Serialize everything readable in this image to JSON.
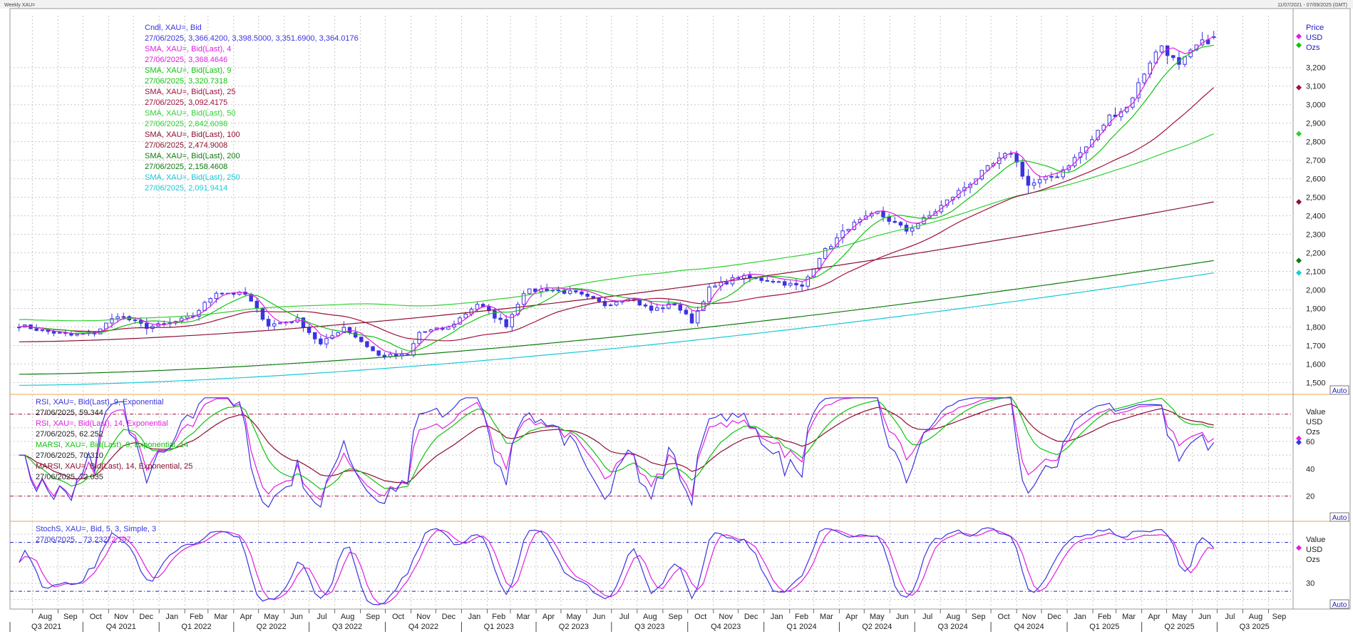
{
  "window": {
    "title": "Weekly XAU=",
    "date_range": "11/07/2021 - 07/09/2025 (GMT)"
  },
  "colors": {
    "candle": "#3a34e0",
    "sma4": "#e01ee0",
    "sma9": "#12c212",
    "sma25": "#a0103c",
    "sma50": "#30d030",
    "sma100": "#8a1030",
    "sma200": "#0e7a0e",
    "sma250": "#19c9d6",
    "rsi9": "#3a34e0",
    "rsi14": "#e01ee0",
    "marsi9": "#12c212",
    "marsi14": "#8a1030",
    "stoch_k": "#3a34e0",
    "stoch_d": "#e01ee0",
    "grid": "#c8c8c8",
    "ref_red": "#b0103c",
    "ref_blue": "#2020c0"
  },
  "legend_main": [
    {
      "label": "Cndl, XAU=, Bid",
      "value": "27/06/2025, 3,366.4200, 3,398.5000, 3,351.6900, 3,364.0176",
      "color": "#3a34e0"
    },
    {
      "label": "SMA, XAU=, Bid(Last),  4",
      "value": "27/06/2025, 3,368.4646",
      "color": "#e01ee0"
    },
    {
      "label": "SMA, XAU=, Bid(Last),  9",
      "value": "27/06/2025, 3,320.7318",
      "color": "#12c212"
    },
    {
      "label": "SMA, XAU=, Bid(Last),  25",
      "value": "27/06/2025, 3,092.4175",
      "color": "#a0103c"
    },
    {
      "label": "SMA, XAU=, Bid(Last),  50",
      "value": "27/06/2025, 2,842.6098",
      "color": "#30d030"
    },
    {
      "label": "SMA, XAU=, Bid(Last),  100",
      "value": "27/06/2025, 2,474.9008",
      "color": "#8a1030"
    },
    {
      "label": "SMA, XAU=, Bid(Last),  200",
      "value": "27/06/2025, 2,158.4608",
      "color": "#0e7a0e"
    },
    {
      "label": "SMA, XAU=, Bid(Last),  250",
      "value": "27/06/2025, 2,091.9414",
      "color": "#19c9d6"
    }
  ],
  "legend_rsi": [
    {
      "label": "RSI, XAU=, Bid(Last),  9, Exponential",
      "value": "27/06/2025, 59.344",
      "color": "#3a34e0"
    },
    {
      "label": "RSI, XAU=, Bid(Last),  14, Exponential",
      "value": "27/06/2025, 62.252",
      "color": "#e01ee0"
    },
    {
      "label": "MARSI, XAU=, Bid(Last),  9, Exponential, 14",
      "value": "27/06/2025, 70.310",
      "color": "#12c212"
    },
    {
      "label": "MARSI, XAU=, Bid(Last),  14, Exponential, 25",
      "value": "27/06/2025, 72.035",
      "color": "#8a1030"
    }
  ],
  "legend_stoch": {
    "label": "StochS, XAU=, Bid,  5, 3, Simple, 3",
    "date": "27/06/2025,",
    "k": "73.232,",
    "d": "72.197"
  },
  "right_axis": {
    "main_header": [
      "Price",
      "USD",
      "Ozs"
    ],
    "rsi_header": [
      "Value",
      "USD",
      "Ozs"
    ],
    "stoch_header": [
      "Value",
      "USD",
      "Ozs"
    ],
    "auto_label": "Auto"
  },
  "chart_data": [
    {
      "type": "line",
      "title": "",
      "xlabel": "",
      "ylabel": "Price",
      "y_ticks": [
        "1,500",
        "1,600",
        "1,700",
        "1,800",
        "1,900",
        "2,000",
        "2,100",
        "2,200",
        "2,300",
        "2,400",
        "2,500",
        "2,600",
        "2,700",
        "2,800",
        "2,900",
        "3,000",
        "3,100",
        "3,200"
      ],
      "ylim": [
        1440,
        3480
      ],
      "xlim": [
        "2021-07-05",
        "2025-09-29"
      ],
      "grid": true,
      "legend_position": "top-left",
      "x_month_ticks": [
        "Aug",
        "Sep",
        "Oct",
        "Nov",
        "Dec",
        "Jan",
        "Feb",
        "Mar",
        "Apr",
        "May",
        "Jun",
        "Jul",
        "Aug",
        "Sep",
        "Oct",
        "Nov",
        "Dec",
        "Jan",
        "Feb",
        "Mar",
        "Apr",
        "May",
        "Jun",
        "Jul",
        "Aug",
        "Sep",
        "Oct",
        "Nov",
        "Dec",
        "Jan",
        "Feb",
        "Mar",
        "Apr",
        "May",
        "Jun",
        "Jul",
        "Aug",
        "Sep",
        "Oct",
        "Nov",
        "Dec",
        "Jan",
        "Feb",
        "Mar",
        "Apr",
        "May",
        "Jun",
        "Jul",
        "Aug",
        "Sep"
      ],
      "x_quarter_ticks": [
        "Q3 2021",
        "Q4 2021",
        "Q1 2022",
        "Q2 2022",
        "Q3 2022",
        "Q4 2022",
        "Q1 2023",
        "Q2 2023",
        "Q3 2023",
        "Q4 2023",
        "Q1 2024",
        "Q2 2024",
        "Q3 2024",
        "Q4 2024",
        "Q1 2025",
        "Q2 2025",
        "Q3 2025"
      ],
      "close_anchors": [
        [
          "2021-07-16",
          1810
        ],
        [
          "2021-08-13",
          1780
        ],
        [
          "2021-09-17",
          1755
        ],
        [
          "2021-10-15",
          1768
        ],
        [
          "2021-11-12",
          1865
        ],
        [
          "2021-12-17",
          1800
        ],
        [
          "2022-01-14",
          1818
        ],
        [
          "2022-02-11",
          1860
        ],
        [
          "2022-03-11",
          1990
        ],
        [
          "2022-04-15",
          1975
        ],
        [
          "2022-05-13",
          1810
        ],
        [
          "2022-06-17",
          1840
        ],
        [
          "2022-07-15",
          1705
        ],
        [
          "2022-08-12",
          1800
        ],
        [
          "2022-09-23",
          1645
        ],
        [
          "2022-10-28",
          1645
        ],
        [
          "2022-11-11",
          1770
        ],
        [
          "2022-12-16",
          1795
        ],
        [
          "2023-01-20",
          1925
        ],
        [
          "2023-02-24",
          1810
        ],
        [
          "2023-03-17",
          1990
        ],
        [
          "2023-04-14",
          2005
        ],
        [
          "2023-05-19",
          1980
        ],
        [
          "2023-06-23",
          1920
        ],
        [
          "2023-07-21",
          1960
        ],
        [
          "2023-08-18",
          1890
        ],
        [
          "2023-09-15",
          1925
        ],
        [
          "2023-10-06",
          1830
        ],
        [
          "2023-10-27",
          2005
        ],
        [
          "2023-12-01",
          2070
        ],
        [
          "2024-01-12",
          2050
        ],
        [
          "2024-02-16",
          2015
        ],
        [
          "2024-03-08",
          2180
        ],
        [
          "2024-04-12",
          2340
        ],
        [
          "2024-05-17",
          2415
        ],
        [
          "2024-06-21",
          2320
        ],
        [
          "2024-07-19",
          2400
        ],
        [
          "2024-08-16",
          2505
        ],
        [
          "2024-09-27",
          2655
        ],
        [
          "2024-10-25",
          2745
        ],
        [
          "2024-11-15",
          2565
        ],
        [
          "2024-12-20",
          2620
        ],
        [
          "2025-01-24",
          2770
        ],
        [
          "2025-02-21",
          2935
        ],
        [
          "2025-03-14",
          2985
        ],
        [
          "2025-04-11",
          3235
        ],
        [
          "2025-04-25",
          3320
        ],
        [
          "2025-05-16",
          3205
        ],
        [
          "2025-06-06",
          3315
        ],
        [
          "2025-06-27",
          3364
        ]
      ],
      "series": [
        {
          "name": "Cndl, XAU=, Bid",
          "last": [
            3366.42,
            3398.5,
            3351.69,
            3364.0176
          ]
        },
        {
          "name": "SMA, XAU=, Bid(Last),  4",
          "last": 3368.4646
        },
        {
          "name": "SMA, XAU=, Bid(Last),  9",
          "last": 3320.7318
        },
        {
          "name": "SMA, XAU=, Bid(Last),  25",
          "last": 3092.4175
        },
        {
          "name": "SMA, XAU=, Bid(Last),  50",
          "last": 2842.6098
        },
        {
          "name": "SMA, XAU=, Bid(Last),  100",
          "last": 2474.9008
        },
        {
          "name": "SMA, XAU=, Bid(Last),  200",
          "last": 2158.4608
        },
        {
          "name": "SMA, XAU=, Bid(Last),  250",
          "last": 2091.9414
        }
      ]
    },
    {
      "type": "line",
      "title": "",
      "ylabel": "Value",
      "y_ticks": [
        "20",
        "40",
        "60"
      ],
      "ylim": [
        2,
        94
      ],
      "reference_lines": [
        80,
        20
      ],
      "grid": true,
      "series": [
        {
          "name": "RSI, XAU=, Bid(Last),  9, Exponential",
          "last": 59.344
        },
        {
          "name": "RSI, XAU=, Bid(Last),  14, Exponential",
          "last": 62.252
        },
        {
          "name": "MARSI, XAU=, Bid(Last),  9, Exponential, 14",
          "last": 70.31
        },
        {
          "name": "MARSI, XAU=, Bid(Last),  14, Exponential, 25",
          "last": 72.035
        }
      ]
    },
    {
      "type": "line",
      "title": "",
      "ylabel": "Value",
      "y_ticks": [
        "30"
      ],
      "ylim": [
        0,
        105
      ],
      "reference_lines": [
        80,
        20
      ],
      "grid": true,
      "series": [
        {
          "name": "StochS %K",
          "last": 73.232
        },
        {
          "name": "StochS %D",
          "last": 72.197
        }
      ]
    }
  ]
}
